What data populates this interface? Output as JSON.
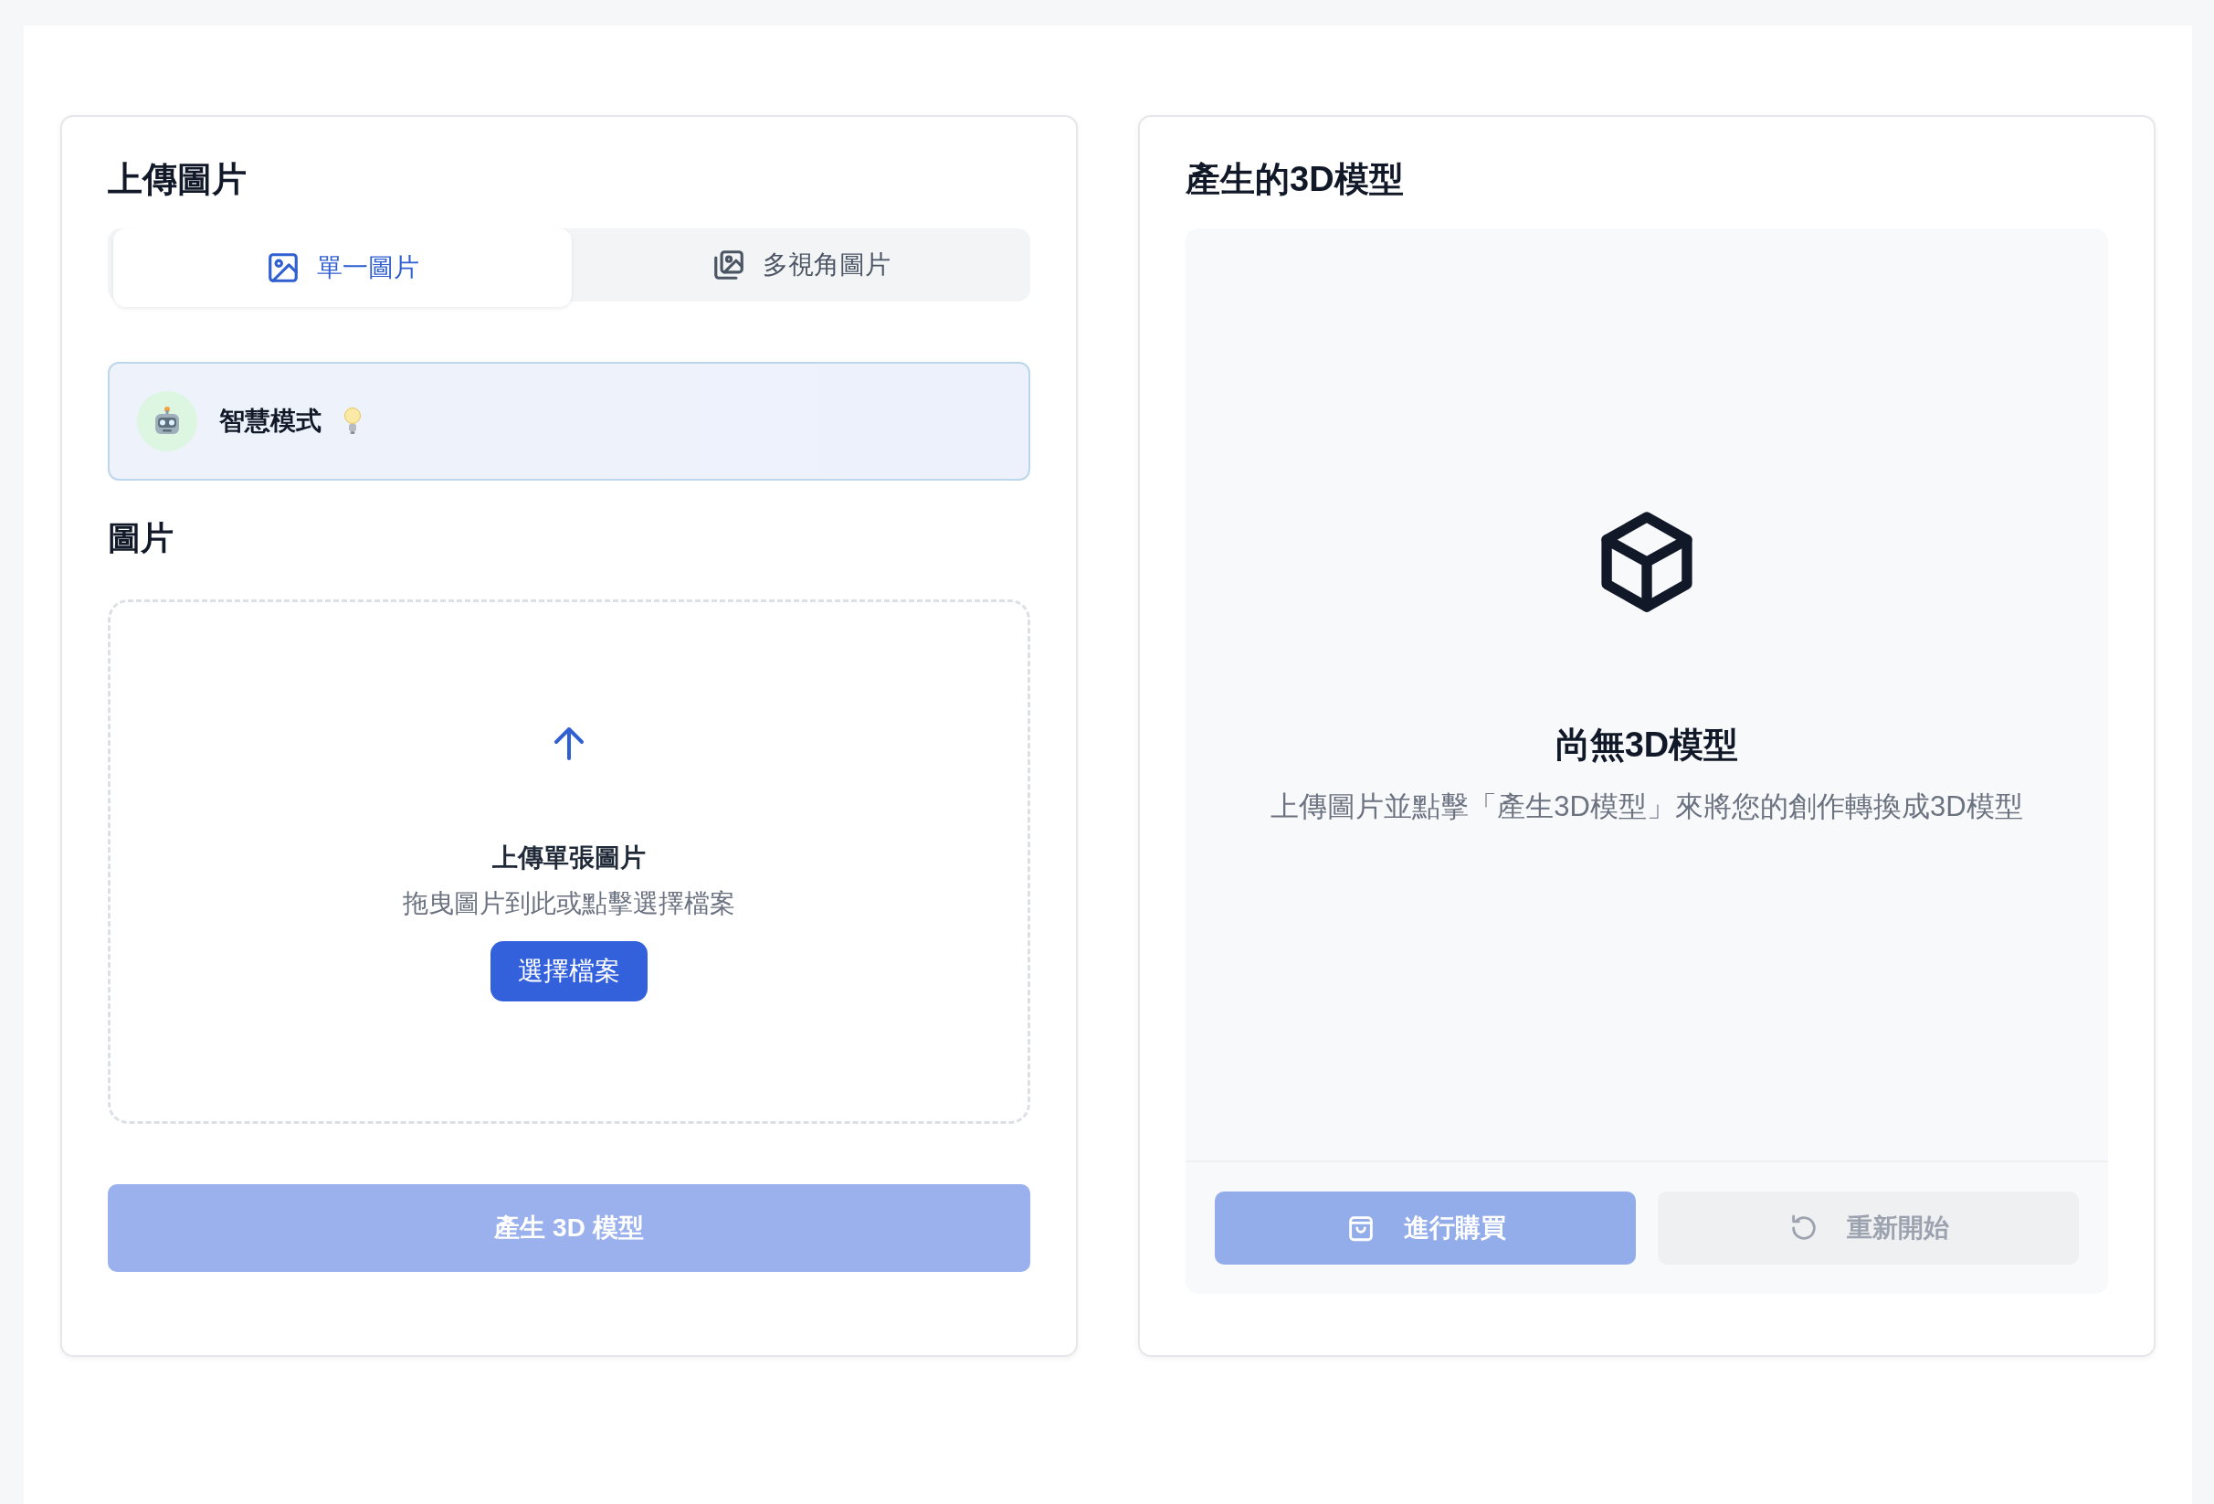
{
  "upload_panel": {
    "title": "上傳圖片",
    "tabs": [
      {
        "label": "單一圖片",
        "selected": true,
        "kind": "single"
      },
      {
        "label": "多視角圖片",
        "selected": false,
        "kind": "multi"
      }
    ],
    "smart_mode": {
      "label": "智慧模式"
    },
    "image_label": "圖片",
    "dropzone": {
      "title": "上傳單張圖片",
      "hint": "拖曳圖片到此或點擊選擇檔案",
      "button": "選擇檔案"
    },
    "generate_button": {
      "label": "產生 3D 模型",
      "disabled": true
    }
  },
  "model_panel": {
    "title": "產生的3D模型",
    "empty_state": {
      "title": "尚無3D模型",
      "description": "上傳圖片並點擊「產生3D模型」來將您的創作轉換成3D模型"
    },
    "buttons": [
      {
        "label": "進行購買",
        "kind": "purchase",
        "disabled": true
      },
      {
        "label": "重新開始",
        "kind": "restart",
        "disabled": true
      }
    ]
  }
}
